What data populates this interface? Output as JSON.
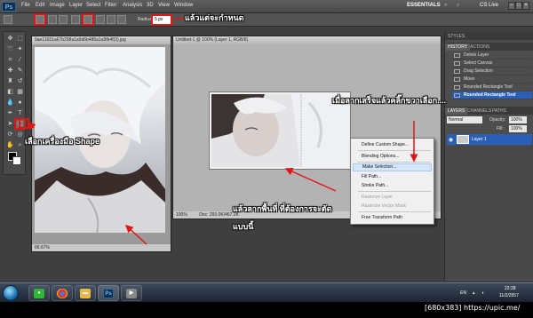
{
  "menubar": {
    "logo": "Ps",
    "items": [
      "File",
      "Edit",
      "Image",
      "Layer",
      "Select",
      "Filter",
      "Analysis",
      "3D",
      "View",
      "Window"
    ],
    "essentials": "ESSENTIALS",
    "cs_live": "CS Live"
  },
  "options": {
    "radius_label": "Radius:",
    "radius_value": "5 px"
  },
  "doc1": {
    "title": "9ae11651a67b298a1a9d6b486a1a9fb4f(3).jpg",
    "status": "66.67%"
  },
  "doc2": {
    "title": "Untitled-1 @ 100% (Layer 1, RGB/8)",
    "status_zoom": "100%",
    "status_doc": "Doc: 293.0K/467.2K"
  },
  "panels": {
    "styles_tab": "STYLES",
    "history_tab": "HISTORY",
    "actions_tab": "ACTIONS",
    "history_items": [
      "Delete Layer",
      "Select Canvas",
      "Drag Selection",
      "Move",
      "Rounded Rectangle Tool",
      "Rounded Rectangle Tool"
    ],
    "layers_tab": "LAYERS",
    "channels_tab": "CHANNELS",
    "paths_tab": "PATHS",
    "blend_mode": "Normal",
    "opacity_label": "Opacity:",
    "opacity_value": "100%",
    "fill_label": "Fill:",
    "fill_value": "100%",
    "layer_name": "Layer 1"
  },
  "context_menu": {
    "items": [
      "Define Custom Shape...",
      "Blending Options...",
      "Make Selection...",
      "Fill Path...",
      "Stroke Path...",
      "Rasterize Layer",
      "Rasterize Vector Mask",
      "Free Transform Path"
    ]
  },
  "annotations": {
    "top": "แล้วแต่จะกำหนด",
    "shape_tool": "เลือกเครื่องมือ Shape",
    "drag": "แล้วลากพื้นที่ ที่ต้องการจะตัด",
    "drag2": "แบบนี้",
    "rightclick": "เมื่อลากเสร็จแล้วคลิ๊กขวาเลือก...."
  },
  "taskbar": {
    "lang": "EN",
    "time": "22:28",
    "date": "11/2/2557",
    "ps_label": "Ps"
  },
  "watermark": "[680x383] https://upic.me/",
  "colors": {
    "annotation_red": "#e01616",
    "selection_blue": "#2a5fb8",
    "menu_hover": "#d6e6fa"
  }
}
